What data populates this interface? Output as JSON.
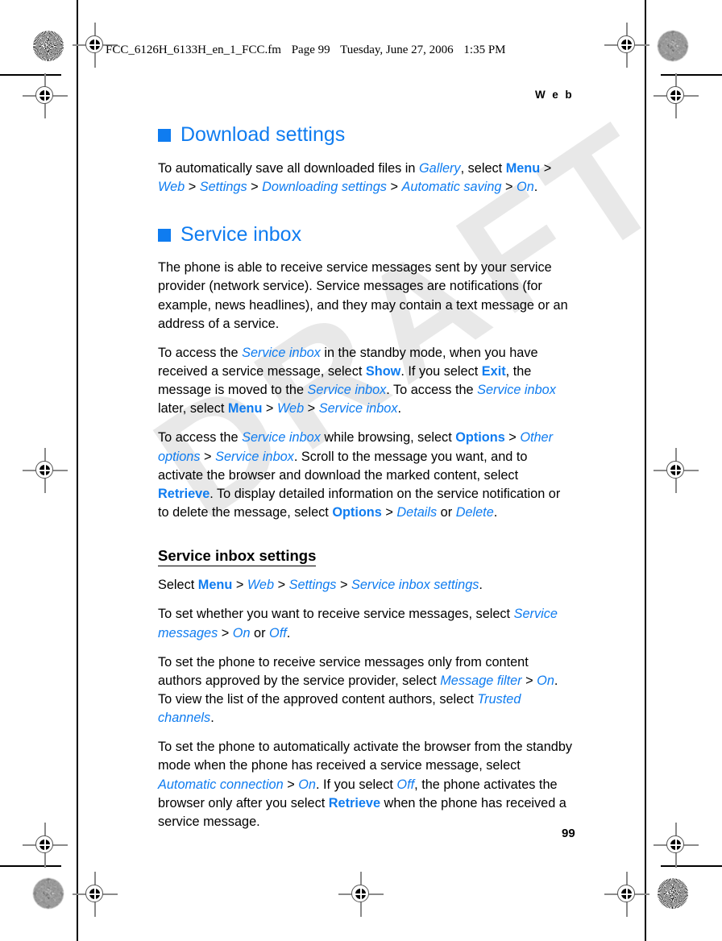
{
  "print_marks": {
    "watermark_text": "DRAFT",
    "accent_color": "#0f7cf0"
  },
  "file_slug": {
    "filename": "FCC_6126H_6133H_en_1_FCC.fm",
    "page_label": "Page 99",
    "weekday_date": "Tuesday, June 27, 2006",
    "time": "1:35 PM"
  },
  "running_head": "W e b",
  "folio": "99",
  "sections": [
    {
      "heading": "Download settings",
      "paragraphs": [
        {
          "runs": [
            {
              "t": "To automatically save all downloaded files in ",
              "s": "plain"
            },
            {
              "t": "Gallery",
              "s": "ui-italic"
            },
            {
              "t": ", select ",
              "s": "plain"
            },
            {
              "t": "Menu",
              "s": "ui-bold"
            },
            {
              "t": " > ",
              "s": "sep"
            },
            {
              "t": "Web",
              "s": "ui-italic"
            },
            {
              "t": " > ",
              "s": "sep"
            },
            {
              "t": "Settings",
              "s": "ui-italic"
            },
            {
              "t": " > ",
              "s": "sep"
            },
            {
              "t": "Downloading settings",
              "s": "ui-italic"
            },
            {
              "t": " > ",
              "s": "sep"
            },
            {
              "t": "Automatic saving",
              "s": "ui-italic"
            },
            {
              "t": " > ",
              "s": "sep"
            },
            {
              "t": "On",
              "s": "ui-italic"
            },
            {
              "t": ".",
              "s": "plain"
            }
          ]
        }
      ]
    },
    {
      "heading": "Service inbox",
      "paragraphs": [
        {
          "runs": [
            {
              "t": "The phone is able to receive service messages sent by your service provider (network service). Service messages are notifications (for example, news headlines), and they may contain a text message or an address of a service.",
              "s": "plain"
            }
          ]
        },
        {
          "runs": [
            {
              "t": "To access the ",
              "s": "plain"
            },
            {
              "t": "Service inbox",
              "s": "ui-italic"
            },
            {
              "t": " in the standby mode, when you have received a service message, select ",
              "s": "plain"
            },
            {
              "t": "Show",
              "s": "ui-bold"
            },
            {
              "t": ". If you select ",
              "s": "plain"
            },
            {
              "t": "Exit",
              "s": "ui-bold"
            },
            {
              "t": ", the message is moved to the ",
              "s": "plain"
            },
            {
              "t": "Service inbox",
              "s": "ui-italic"
            },
            {
              "t": ". To access the ",
              "s": "plain"
            },
            {
              "t": "Service inbox",
              "s": "ui-italic"
            },
            {
              "t": " later, select ",
              "s": "plain"
            },
            {
              "t": "Menu",
              "s": "ui-bold"
            },
            {
              "t": " > ",
              "s": "sep"
            },
            {
              "t": "Web",
              "s": "ui-italic"
            },
            {
              "t": " > ",
              "s": "sep"
            },
            {
              "t": "Service inbox",
              "s": "ui-italic"
            },
            {
              "t": ".",
              "s": "plain"
            }
          ]
        },
        {
          "runs": [
            {
              "t": "To access the ",
              "s": "plain"
            },
            {
              "t": "Service inbox",
              "s": "ui-italic"
            },
            {
              "t": " while browsing, select ",
              "s": "plain"
            },
            {
              "t": "Options",
              "s": "ui-bold"
            },
            {
              "t": " > ",
              "s": "sep"
            },
            {
              "t": "Other options",
              "s": "ui-italic"
            },
            {
              "t": " > ",
              "s": "sep"
            },
            {
              "t": "Service inbox",
              "s": "ui-italic"
            },
            {
              "t": ". Scroll to the message you want, and to activate the browser and download the marked content, select ",
              "s": "plain"
            },
            {
              "t": "Retrieve",
              "s": "ui-bold"
            },
            {
              "t": ". To display detailed information on the service notification or to delete the message, select ",
              "s": "plain"
            },
            {
              "t": "Options",
              "s": "ui-bold"
            },
            {
              "t": " > ",
              "s": "sep"
            },
            {
              "t": "Details",
              "s": "ui-italic"
            },
            {
              "t": " or ",
              "s": "plain"
            },
            {
              "t": "Delete",
              "s": "ui-italic"
            },
            {
              "t": ".",
              "s": "plain"
            }
          ]
        }
      ],
      "subsection": {
        "heading": "Service inbox settings",
        "paragraphs": [
          {
            "runs": [
              {
                "t": "Select ",
                "s": "plain"
              },
              {
                "t": "Menu",
                "s": "ui-bold"
              },
              {
                "t": " > ",
                "s": "sep"
              },
              {
                "t": "Web",
                "s": "ui-italic"
              },
              {
                "t": " > ",
                "s": "sep"
              },
              {
                "t": "Settings",
                "s": "ui-italic"
              },
              {
                "t": " > ",
                "s": "sep"
              },
              {
                "t": "Service inbox settings",
                "s": "ui-italic"
              },
              {
                "t": ".",
                "s": "plain"
              }
            ]
          },
          {
            "runs": [
              {
                "t": "To set whether you want to receive service messages, select ",
                "s": "plain"
              },
              {
                "t": "Service messages",
                "s": "ui-italic"
              },
              {
                "t": " > ",
                "s": "sep"
              },
              {
                "t": "On",
                "s": "ui-italic"
              },
              {
                "t": " or ",
                "s": "plain"
              },
              {
                "t": "Off",
                "s": "ui-italic"
              },
              {
                "t": ".",
                "s": "plain"
              }
            ]
          },
          {
            "runs": [
              {
                "t": "To set the phone to receive service messages only from content authors approved by the service provider, select ",
                "s": "plain"
              },
              {
                "t": "Message filter",
                "s": "ui-italic"
              },
              {
                "t": " > ",
                "s": "sep"
              },
              {
                "t": "On",
                "s": "ui-italic"
              },
              {
                "t": ". To view the list of the approved content authors, select ",
                "s": "plain"
              },
              {
                "t": "Trusted channels",
                "s": "ui-italic"
              },
              {
                "t": ".",
                "s": "plain"
              }
            ]
          },
          {
            "runs": [
              {
                "t": "To set the phone to automatically activate the browser from the standby mode when the phone has received a service message, select ",
                "s": "plain"
              },
              {
                "t": "Automatic connection",
                "s": "ui-italic"
              },
              {
                "t": " > ",
                "s": "sep"
              },
              {
                "t": "On",
                "s": "ui-italic"
              },
              {
                "t": ". If you select ",
                "s": "plain"
              },
              {
                "t": "Off",
                "s": "ui-italic"
              },
              {
                "t": ", the phone activates the browser only after you select ",
                "s": "plain"
              },
              {
                "t": "Retrieve",
                "s": "ui-bold"
              },
              {
                "t": " when the phone has received a service message.",
                "s": "plain"
              }
            ]
          }
        ]
      }
    }
  ]
}
